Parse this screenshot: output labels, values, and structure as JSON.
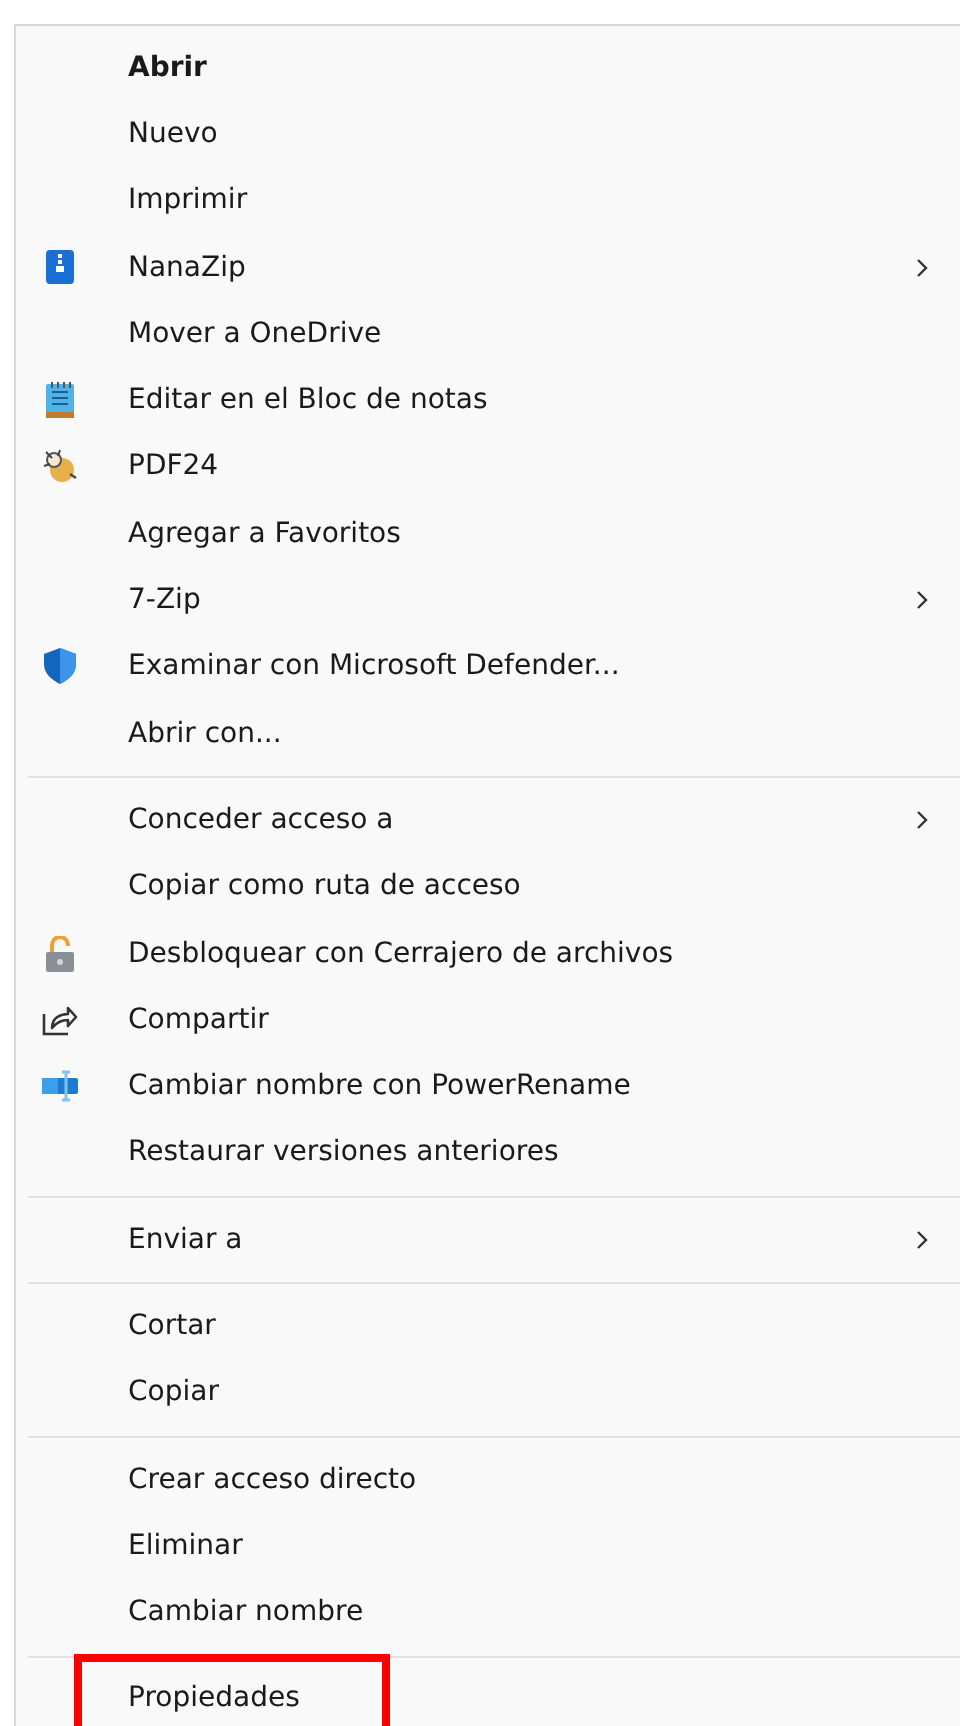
{
  "menu": {
    "groups": [
      {
        "items": [
          {
            "label": "Abrir",
            "default": true,
            "submenu": false
          },
          {
            "label": "Nuevo",
            "default": false,
            "submenu": false
          },
          {
            "label": "Imprimir",
            "default": false,
            "submenu": false
          },
          {
            "label": "NanaZip",
            "default": false,
            "submenu": true,
            "kind": "zip"
          },
          {
            "label": "Mover a OneDrive",
            "default": false,
            "submenu": false
          },
          {
            "label": "Editar en el Bloc de notas",
            "default": false,
            "submenu": false,
            "kind": "notepad"
          },
          {
            "label": "PDF24",
            "default": false,
            "submenu": false,
            "kind": "mascot"
          },
          {
            "label": "Agregar a Favoritos",
            "default": false,
            "submenu": false
          },
          {
            "label": "7-Zip",
            "default": false,
            "submenu": true
          },
          {
            "label": "Examinar con Microsoft Defender...",
            "default": false,
            "submenu": false,
            "kind": "shield"
          },
          {
            "label": "Abrir con...",
            "default": false,
            "submenu": false
          }
        ]
      },
      {
        "items": [
          {
            "label": "Conceder acceso a",
            "default": false,
            "submenu": true
          },
          {
            "label": "Copiar como ruta de acceso",
            "default": false,
            "submenu": false
          },
          {
            "label": "Desbloquear con Cerrajero de archivos",
            "default": false,
            "submenu": false,
            "kind": "lock"
          },
          {
            "label": "Compartir",
            "default": false,
            "submenu": false,
            "kind": "share"
          },
          {
            "label": "Cambiar nombre con PowerRename",
            "default": false,
            "submenu": false,
            "kind": "rename"
          },
          {
            "label": "Restaurar versiones anteriores",
            "default": false,
            "submenu": false
          }
        ]
      },
      {
        "items": [
          {
            "label": "Enviar a",
            "default": false,
            "submenu": true
          }
        ]
      },
      {
        "items": [
          {
            "label": "Cortar",
            "default": false,
            "submenu": false
          },
          {
            "label": "Copiar",
            "default": false,
            "submenu": false
          }
        ]
      },
      {
        "items": [
          {
            "label": "Crear acceso directo",
            "default": false,
            "submenu": false
          },
          {
            "label": "Eliminar",
            "default": false,
            "submenu": false
          },
          {
            "label": "Cambiar nombre",
            "default": false,
            "submenu": false
          }
        ]
      },
      {
        "items": [
          {
            "label": "Propiedades",
            "default": false,
            "submenu": false,
            "highlighted": true
          }
        ]
      }
    ]
  }
}
